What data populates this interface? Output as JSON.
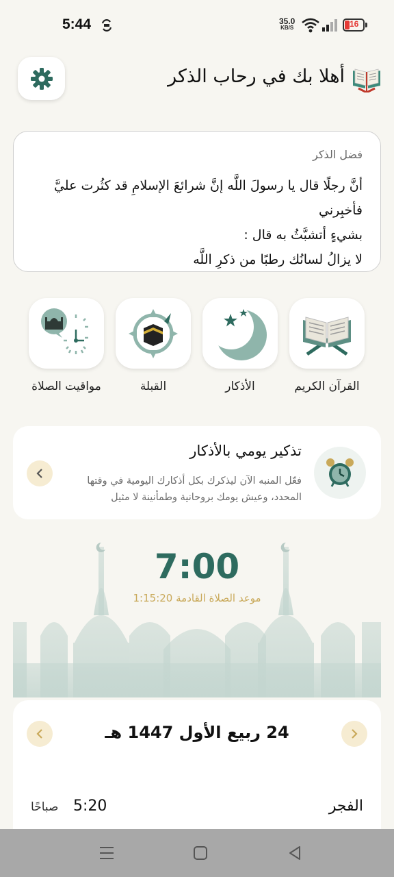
{
  "status": {
    "time": "5:44",
    "speed_value": "35.0",
    "speed_unit": "KB/S",
    "battery": "16",
    "battery_color": "#e53935"
  },
  "header": {
    "title": "أهلا بك في رحاب الذكر",
    "settings_icon": "gear-icon",
    "logo_icon": "open-book-icon"
  },
  "virtue": {
    "label": "فضل الذكر",
    "text_line1": "أنَّ رجلًا قال يا رسولَ اللَّه إنَّ شرائعَ الإسلامِ قد كثُرت عليَّ فأخبِرني",
    "text_line2": "بشيءٍ أتشبَّثُ به قال :",
    "text_line3": "لا يزالُ لسانُك رطبًا من ذكرِ اللَّه"
  },
  "shortcuts": [
    {
      "label": "القرآن الكريم",
      "icon": "quran-icon"
    },
    {
      "label": "الأذكار",
      "icon": "crescent-star-icon"
    },
    {
      "label": "القبلة",
      "icon": "kaaba-compass-icon"
    },
    {
      "label": "مواقيت الصلاة",
      "icon": "mosque-clock-icon"
    }
  ],
  "reminder": {
    "title": "تذكير يومي بالأذكار",
    "text": "فعّل المنبه الآن ليذكرك بكل أذكارك اليومية في وقتها المحدد، وعيش يومك بروحانية وطمأنينة لا مثيل",
    "icon": "alarm-clock-icon"
  },
  "prayer_hero": {
    "time": "7:00",
    "next_label": "موعد الصلاة القادمة",
    "countdown": "1:15:20"
  },
  "date_card": {
    "hijri_date": "24 ربيع الأول 1447 هـ",
    "prayer_name": "الفجر",
    "prayer_time": "5:20",
    "prayer_meridiem": "صباحًا"
  },
  "colors": {
    "accent": "#2e6b5f",
    "gold": "#c9a95a",
    "background": "#f7f6f1"
  }
}
